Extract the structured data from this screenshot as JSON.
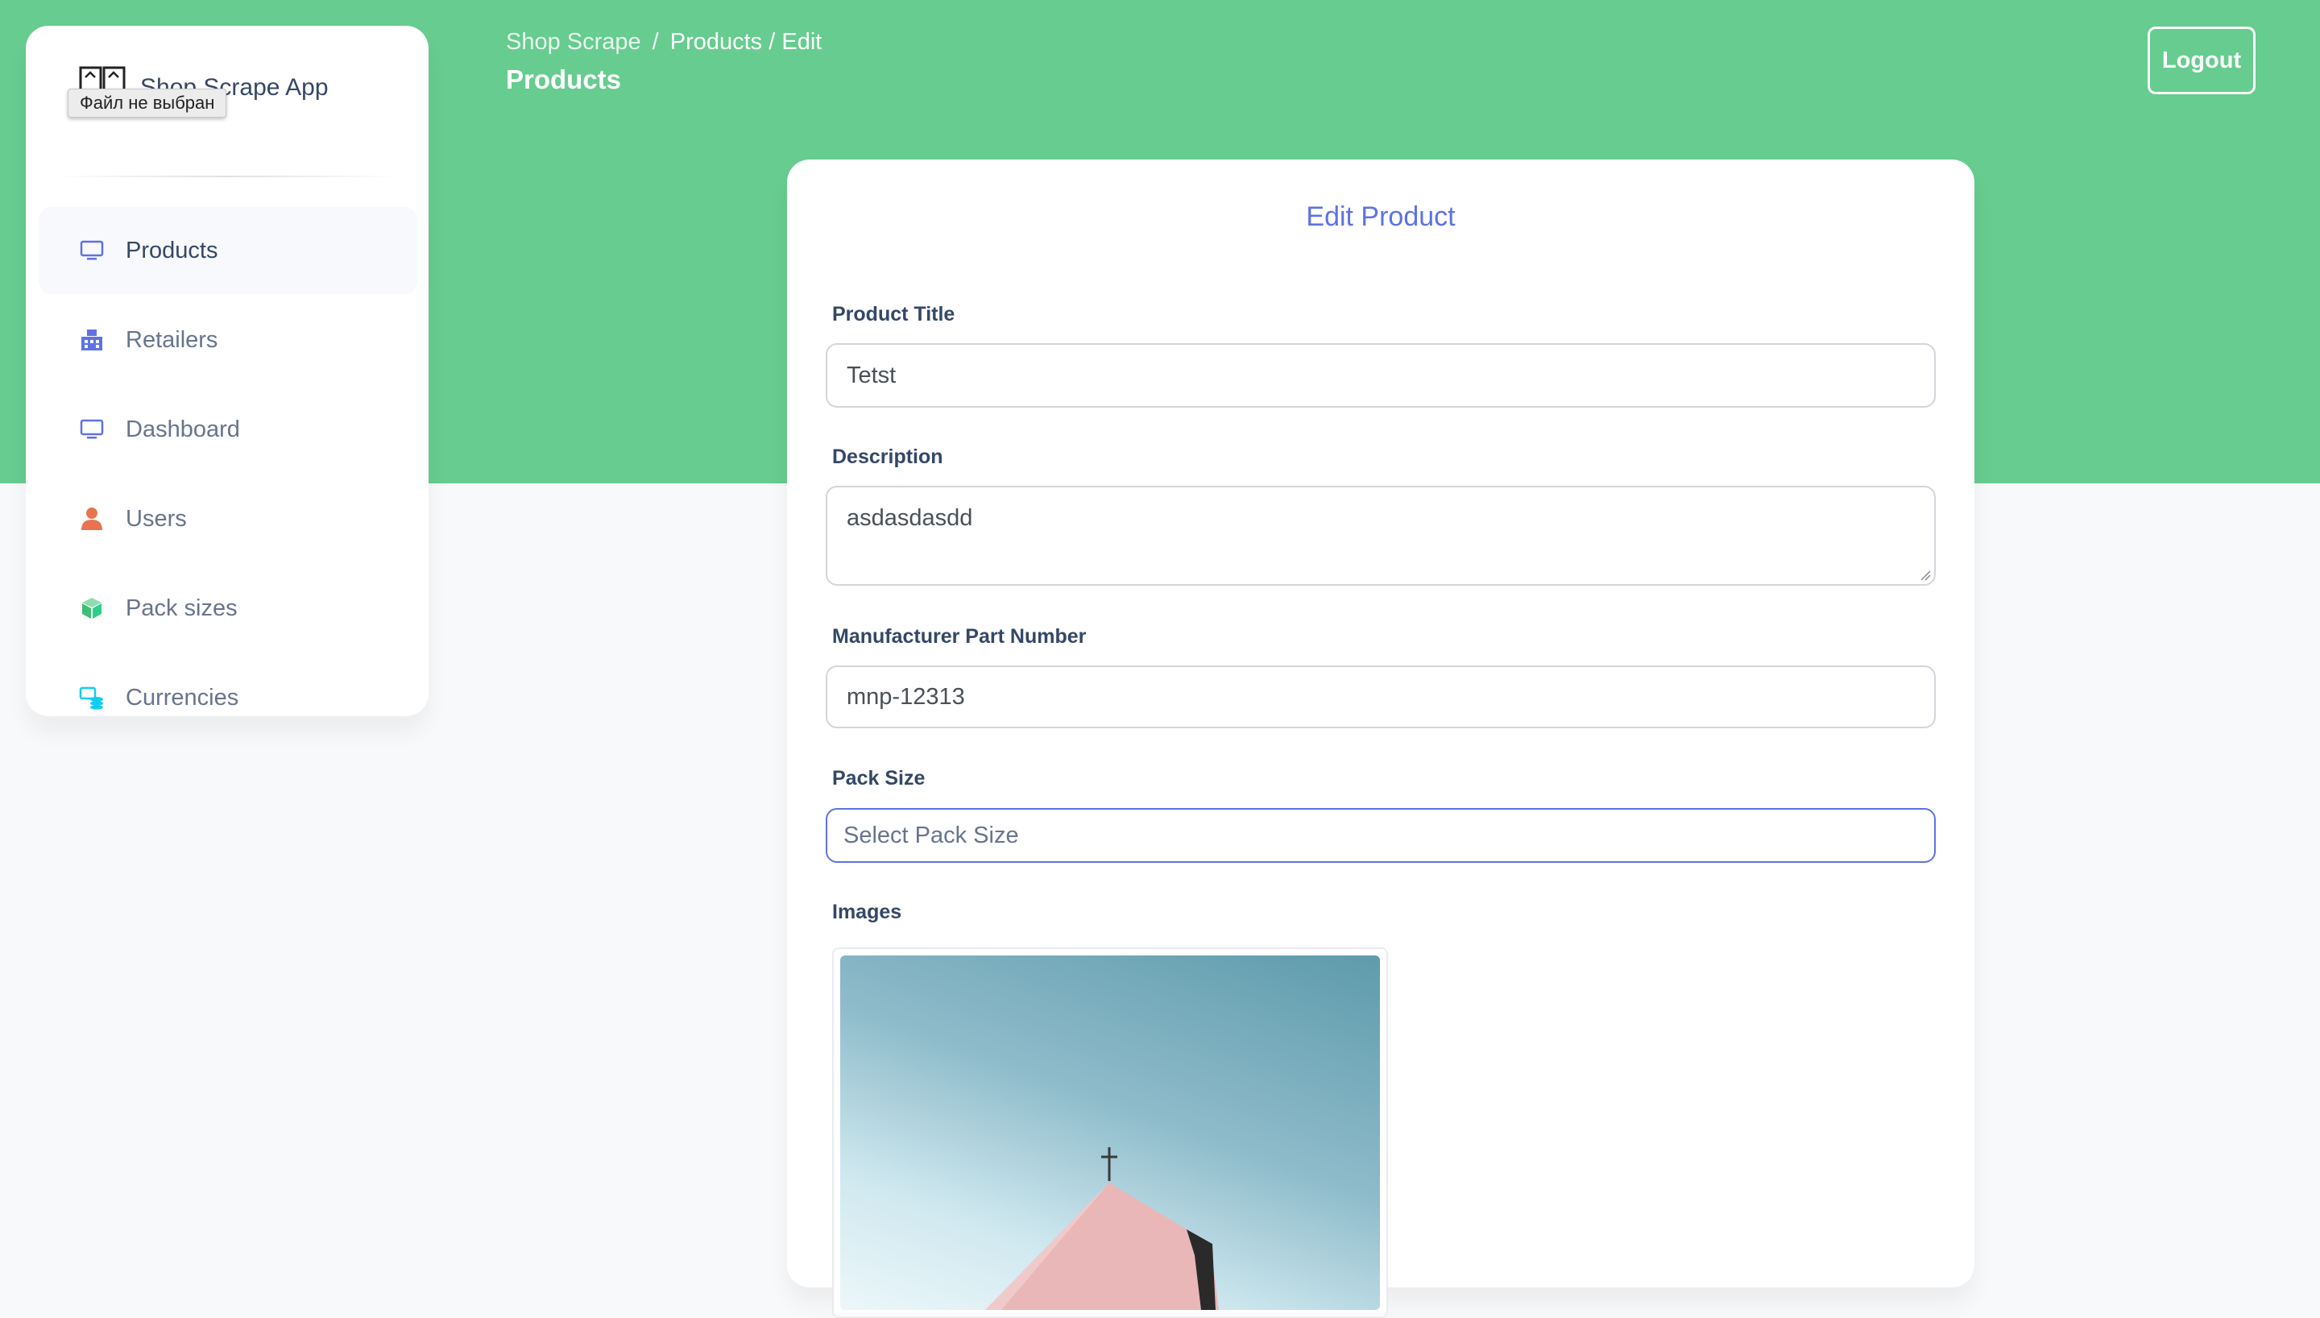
{
  "app": {
    "brand_name": "Shop Scrape App",
    "file_tooltip": "Файл не выбран"
  },
  "sidebar": {
    "items": [
      {
        "label": "Products",
        "icon": "monitor-icon",
        "active": true
      },
      {
        "label": "Retailers",
        "icon": "building-icon",
        "active": false
      },
      {
        "label": "Dashboard",
        "icon": "monitor-icon",
        "active": false
      },
      {
        "label": "Users",
        "icon": "user-icon",
        "active": false
      },
      {
        "label": "Pack sizes",
        "icon": "box-icon",
        "active": false
      },
      {
        "label": "Currencies",
        "icon": "coins-icon",
        "active": false
      }
    ]
  },
  "header": {
    "breadcrumb_root": "Shop Scrape",
    "breadcrumb_separator": "/",
    "breadcrumb_current": "Products / Edit",
    "page_title": "Products",
    "logout_label": "Logout"
  },
  "form": {
    "title": "Edit Product",
    "product_title_label": "Product Title",
    "product_title_value": "Tetst",
    "description_label": "Description",
    "description_value": "asdasdasdd",
    "mpn_label": "Manufacturer Part Number",
    "mpn_value": "mnp-12313",
    "pack_size_label": "Pack Size",
    "pack_size_placeholder": "Select Pack Size",
    "images_label": "Images"
  },
  "colors": {
    "header_green": "#66cc8f",
    "accent_blue": "#5e72e4",
    "page_background": "#f8f9fa"
  }
}
